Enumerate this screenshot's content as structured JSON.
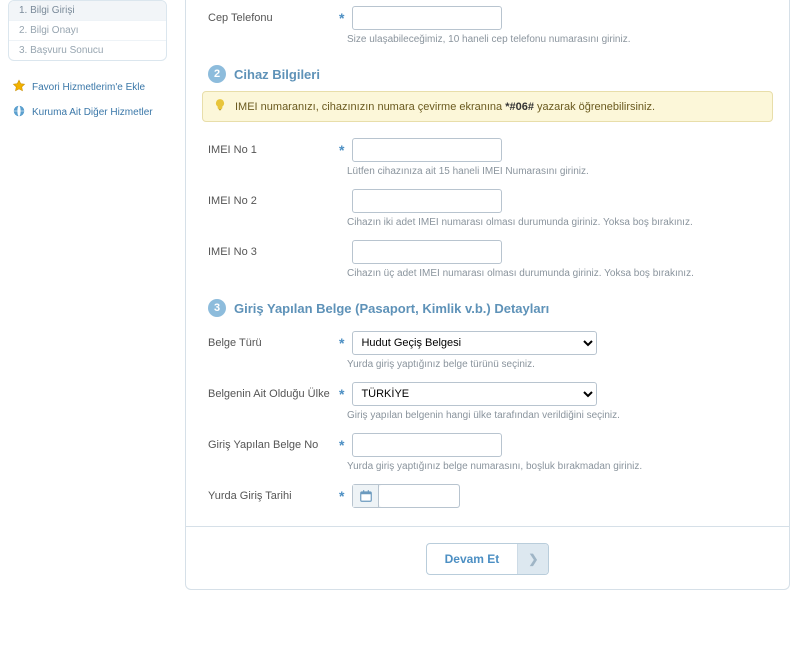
{
  "sidebar": {
    "steps": [
      {
        "label": "1. Bilgi Girişi",
        "active": true
      },
      {
        "label": "2. Bilgi Onayı",
        "active": false
      },
      {
        "label": "3. Başvuru Sonucu",
        "active": false
      }
    ],
    "fav_link": "Favori Hizmetlerim'e Ekle",
    "other_link": "Kuruma Ait Diğer Hizmetler"
  },
  "section1_phone": {
    "label": "Cep Telefonu",
    "hint": "Size ulaşabileceğimiz, 10 haneli cep telefonu numarasını giriniz."
  },
  "section2": {
    "num": "2",
    "title": "Cihaz Bilgileri",
    "info_prefix": "IMEI numaranızı, cihazınızın numara çevirme ekranına ",
    "info_bold": "*#06#",
    "info_suffix": " yazarak öğrenebilirsiniz.",
    "imei1": {
      "label": "IMEI No 1",
      "hint": "Lütfen cihazınıza ait 15 haneli IMEI Numarasını giriniz."
    },
    "imei2": {
      "label": "IMEI No 2",
      "hint": "Cihazın iki adet IMEI numarası olması durumunda giriniz. Yoksa boş bırakınız."
    },
    "imei3": {
      "label": "IMEI No 3",
      "hint": "Cihazın üç adet IMEI numarası olması durumunda giriniz. Yoksa boş bırakınız."
    }
  },
  "section3": {
    "num": "3",
    "title": "Giriş Yapılan Belge (Pasaport, Kimlik v.b.) Detayları",
    "doc_type": {
      "label": "Belge Türü",
      "value": "Hudut Geçiş Belgesi",
      "hint": "Yurda giriş yaptığınız belge türünü seçiniz."
    },
    "doc_country": {
      "label": "Belgenin Ait Olduğu Ülke",
      "value": "TÜRKİYE",
      "hint": "Giriş yapılan belgenin hangi ülke tarafından verildiğini seçiniz."
    },
    "doc_no": {
      "label": "Giriş Yapılan Belge No",
      "hint": "Yurda giriş yaptığınız belge numarasını, boşluk bırakmadan giriniz."
    },
    "entry_date": {
      "label": "Yurda Giriş Tarihi"
    }
  },
  "actions": {
    "next": "Devam Et"
  }
}
